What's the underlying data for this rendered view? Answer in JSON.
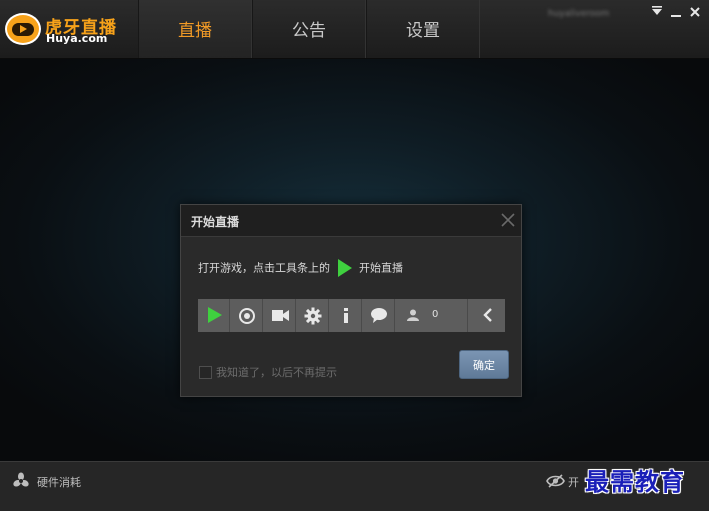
{
  "app": {
    "logo_text": "虎牙直播",
    "logo_subtext": "Huya.com"
  },
  "nav": {
    "tabs": [
      {
        "label": "直播",
        "active": true
      },
      {
        "label": "公告",
        "active": false
      },
      {
        "label": "设置",
        "active": false
      }
    ]
  },
  "account": {
    "name": "huyaliveroom"
  },
  "window_controls": {
    "menu_icon": "dropdown-arrow-icon",
    "minimize_icon": "minimize-icon",
    "close_icon": "close-icon"
  },
  "dialog": {
    "title": "开始直播",
    "instruction_prefix": "打开游戏，点击工具条上的",
    "instruction_suffix": "开始直播",
    "checkbox_label": "我知道了，以后不再提示",
    "checkbox_checked": false,
    "confirm_label": "确定",
    "toolbar": {
      "buttons": [
        "play-icon",
        "record-icon",
        "camera-icon",
        "settings-icon",
        "info-icon",
        "chat-icon"
      ],
      "viewer_count": "0",
      "collapse_icon": "chevron-left-icon"
    }
  },
  "footer": {
    "left_label": "硬件消耗",
    "right_label": "开"
  },
  "watermark": "最需教育",
  "colors": {
    "accent": "#f19a26",
    "play_green": "#3fd03f",
    "confirm_blue": "#6c87a6"
  }
}
